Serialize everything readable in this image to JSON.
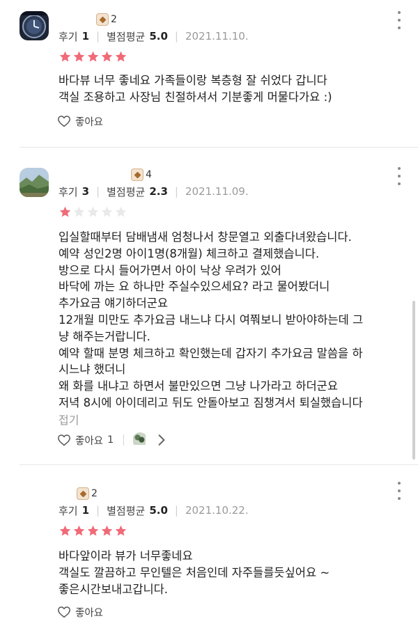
{
  "reviews": [
    {
      "badge_count": "2",
      "review_label": "후기",
      "review_count": "1",
      "avg_label": "별점평균",
      "avg_rating": "5.0",
      "date": "2021.11.10.",
      "stars": 5,
      "text": "바다뷰 너무 좋네요 가족들이랑 복층형 잘 쉬었다 갑니다\n객실 조용하고 사장님 친절하셔서 기분좋게 머물다가요 :)",
      "like_label": "좋아요",
      "like_count": ""
    },
    {
      "badge_count": "4",
      "review_label": "후기",
      "review_count": "3",
      "avg_label": "별점평균",
      "avg_rating": "2.3",
      "date": "2021.11.09.",
      "stars": 1,
      "text": "입실할때부터 담배냄새 엄청나서 창문열고 외출다녀왔습니다.\n예약 성인2명 아이1명(8개월) 체크하고 결제했습니다.\n방으로 다시 들어가면서 아이 낙상 우려가 있어\n바닥에 까는 요 하나만 주실수있으세요? 라고 물어봤더니\n추가요금 얘기하더군요\n12개월 미만도 추가요금 내느냐 다시 여쭤보니 받아야하는데 그\n냥 해주는거랍니다.\n예약 할때 분명 체크하고 확인했는데 갑자기 추가요금 말씀을 하\n시느냐 했더니\n왜 화를 내냐고 하면서 불만있으면 그냥 나가라고 하더군요\n저녁 8시에 아이데리고 뒤도 안돌아보고 짐챙겨서 퇴실했습니다",
      "fold_label": "접기",
      "like_label": "좋아요",
      "like_count": "1"
    },
    {
      "badge_count": "2",
      "review_label": "후기",
      "review_count": "1",
      "avg_label": "별점평균",
      "avg_rating": "5.0",
      "date": "2021.10.22.",
      "stars": 5,
      "text": "바다앞이라 뷰가 너무좋네요\n객실도 깔끔하고 무인텔은 처음인데 자주들를듯싶어요 ~\n좋은시간보내고갑니다.",
      "like_label": "좋아요",
      "like_count": ""
    }
  ],
  "colors": {
    "star_filled": "#f06a78",
    "star_empty": "#e9e9e9",
    "date": "#9a9a9a"
  },
  "icons": [
    "clock-avatar",
    "landscape-avatar",
    "heart-outline-icon",
    "star-icon",
    "more-vertical-icon",
    "chevron-right-icon",
    "badge-hex-icon"
  ]
}
